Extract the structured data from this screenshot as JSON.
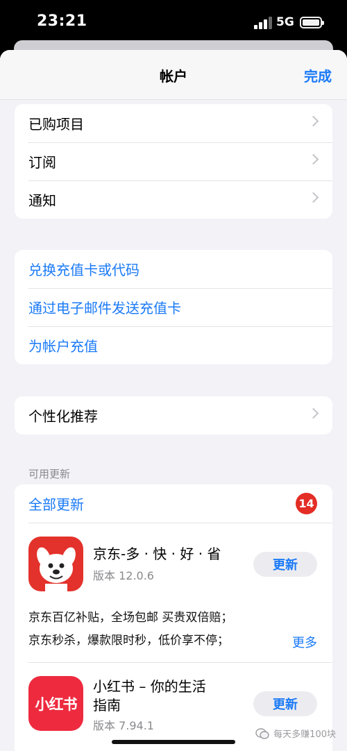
{
  "status": {
    "time": "23:21",
    "network": "5G"
  },
  "nav": {
    "title": "帐户",
    "done_label": "完成"
  },
  "group1": [
    {
      "label": "已购项目"
    },
    {
      "label": "订阅"
    },
    {
      "label": "通知"
    }
  ],
  "group2": [
    {
      "label": "兑换充值卡或代码"
    },
    {
      "label": "通过电子邮件发送充值卡"
    },
    {
      "label": "为帐户充值"
    }
  ],
  "group3": [
    {
      "label": "个性化推荐"
    }
  ],
  "updates": {
    "section_label": "可用更新",
    "update_all_label": "全部更新",
    "count": "14",
    "apps": [
      {
        "name": "京东-多 · 快 · 好 · 省",
        "version": "版本 12.0.6",
        "button": "更新",
        "notes": [
          "京东百亿补贴，全场包邮 买贵双倍赔；",
          "京东秒杀，爆款限时秒，低价享不停；"
        ],
        "more": "更多"
      },
      {
        "name_line1": "小红书 – 你的生活",
        "name_line2": "指南",
        "version": "版本 7.94.1",
        "button": "更新",
        "icon_text": "小红书"
      }
    ]
  },
  "watermark": "每天多赚100块",
  "colors": {
    "accent": "#1a7af7",
    "badge": "#e32d25",
    "jd_red": "#e3322b",
    "xhs_red": "#ee2a3f"
  }
}
